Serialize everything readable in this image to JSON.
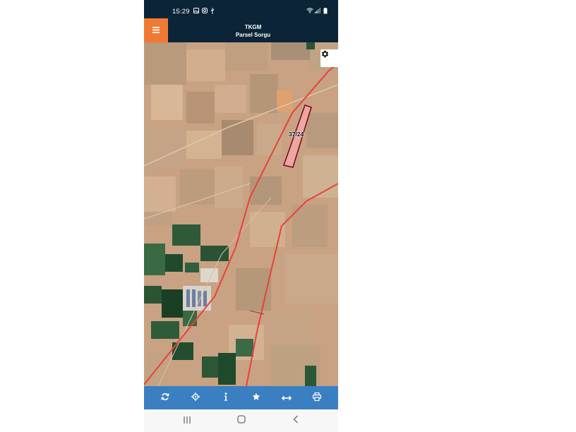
{
  "status_bar": {
    "time": "15:29",
    "left_icons": [
      "gallery-icon",
      "instagram-icon",
      "usb-icon"
    ],
    "right_icons": [
      "wifi-icon",
      "signal-icon",
      "battery-icon"
    ]
  },
  "app_bar": {
    "title_line1": "TKGM",
    "title_line2": "Parsel Sorgu",
    "menu_icon": "hamburger-menu-icon",
    "accent_color": "#f07a33",
    "bar_color": "#0b2438"
  },
  "map": {
    "settings_icon": "gear-icon",
    "parcel_label": "37/24",
    "boundary_color": "#e8423c",
    "parcel_fill": "#f3a7a7"
  },
  "toolbar": {
    "color": "#3a7fc2",
    "buttons": [
      {
        "icon": "refresh-icon"
      },
      {
        "icon": "locate-icon"
      },
      {
        "icon": "info-icon"
      },
      {
        "icon": "star-icon"
      },
      {
        "icon": "measure-icon"
      },
      {
        "icon": "print-icon"
      }
    ]
  },
  "nav_bar": {
    "buttons": [
      "recent-apps-icon",
      "home-icon",
      "back-icon"
    ]
  }
}
